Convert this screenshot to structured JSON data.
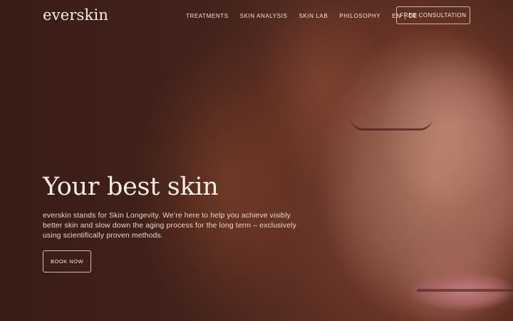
{
  "brand": {
    "logo_text": "everskin"
  },
  "nav": {
    "items": [
      {
        "label": "TREATMENTS"
      },
      {
        "label": "SKIN ANALYSIS"
      },
      {
        "label": "SKIN LAB"
      },
      {
        "label": "PHILOSOPHY"
      }
    ],
    "languages": [
      "EN",
      "DE"
    ],
    "cta_label": "FREE CONSULTATION"
  },
  "hero": {
    "headline": "Your best skin",
    "lead": "everskin stands for Skin Longevity. We’re here to help you achieve visibly better skin and slow down the aging process for the long term – exclusively using scientifically proven methods.",
    "button_label": "BOOK NOW",
    "image": "portrait of woman with closed eyes and auburn hair"
  },
  "colors": {
    "overlay": "#3a1f19",
    "text": "#f3e9e2"
  }
}
